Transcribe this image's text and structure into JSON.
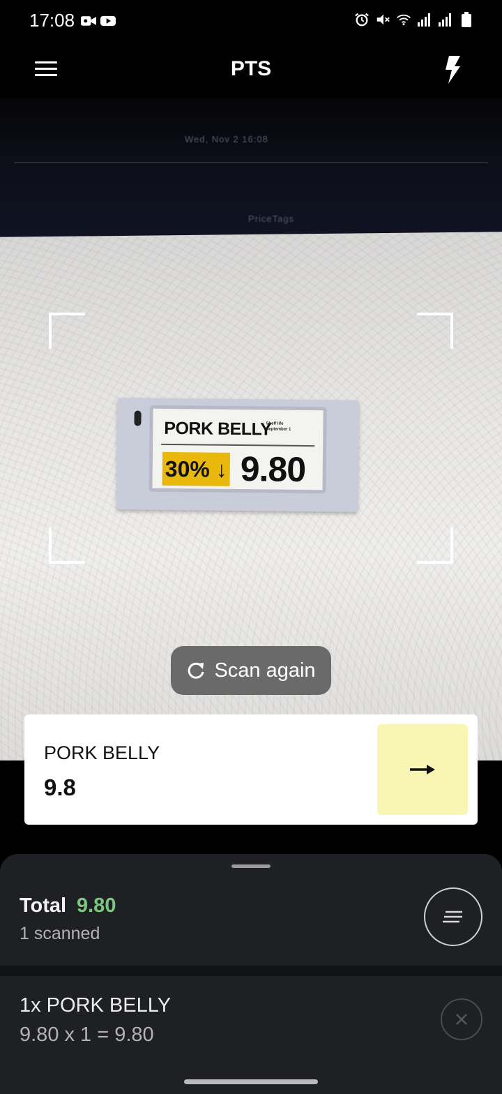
{
  "status_bar": {
    "time": "17:08",
    "left_icons": [
      "video-recording-icon",
      "youtube-icon"
    ],
    "right_icons": [
      "alarm-icon",
      "mute-icon",
      "wifi-icon",
      "signal-icon",
      "signal-icon",
      "battery-icon"
    ]
  },
  "app_bar": {
    "title": "PTS",
    "menu_icon": "hamburger-menu-icon",
    "flash_icon": "flash-icon"
  },
  "camera": {
    "background_text": {
      "date_line": "Wed, Nov 2  16:08",
      "app_name_line": "PriceTags"
    },
    "price_tag": {
      "product": "PORK BELLY",
      "shelf_life_line1": "Shelf life",
      "shelf_life_line2": "September 1",
      "discount": "30% ↓",
      "price": "9.80",
      "badge_color": "#e8b90c"
    }
  },
  "scan_again": {
    "label": "Scan again",
    "icon": "refresh-icon"
  },
  "result": {
    "product_name": "PORK BELLY",
    "price": "9.8",
    "action_icon": "arrow-right-icon",
    "action_color": "#f8f6b2"
  },
  "summary": {
    "total_label": "Total",
    "total_value": "9.80",
    "total_color": "#7bc77f",
    "scanned": "1 scanned",
    "list_icon": "list-icon"
  },
  "items": [
    {
      "title": "1x PORK BELLY",
      "calc": "9.80 x 1 = 9.80",
      "remove_icon": "close-icon"
    }
  ]
}
